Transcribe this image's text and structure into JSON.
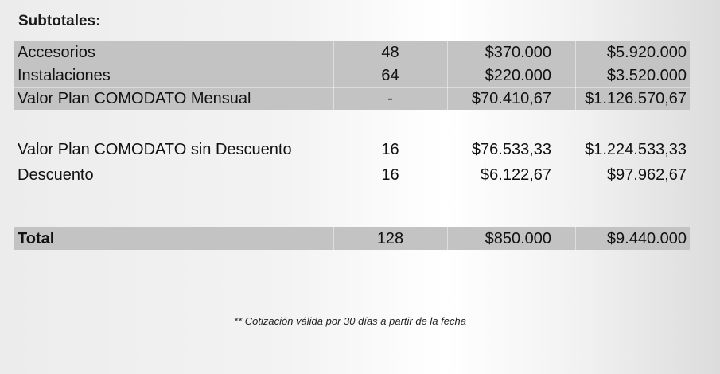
{
  "subtotals": {
    "title": "Subtotales:",
    "rows": [
      {
        "label": "Accesorios",
        "qty": "48",
        "unit": "$370.000",
        "total": "$5.920.000"
      },
      {
        "label": "Instalaciones",
        "qty": "64",
        "unit": "$220.000",
        "total": "$3.520.000"
      },
      {
        "label": "Valor Plan COMODATO Mensual",
        "qty": "-",
        "unit": "$70.410,67",
        "total": "$1.126.570,67"
      }
    ]
  },
  "discount": {
    "rows": [
      {
        "label": "Valor Plan COMODATO sin Descuento",
        "qty": "16",
        "unit": "$76.533,33",
        "total": "$1.224.533,33"
      },
      {
        "label": "Descuento",
        "qty": "16",
        "unit": "$6.122,67",
        "total": "$97.962,67"
      }
    ]
  },
  "total": {
    "label": "Total",
    "qty": "128",
    "unit": "$850.000",
    "total": "$9.440.000"
  },
  "note": "** Cotización válida por 30 días a partir de la fecha",
  "colors": {
    "row_shade": "#c3c3c3",
    "text": "#111111"
  }
}
